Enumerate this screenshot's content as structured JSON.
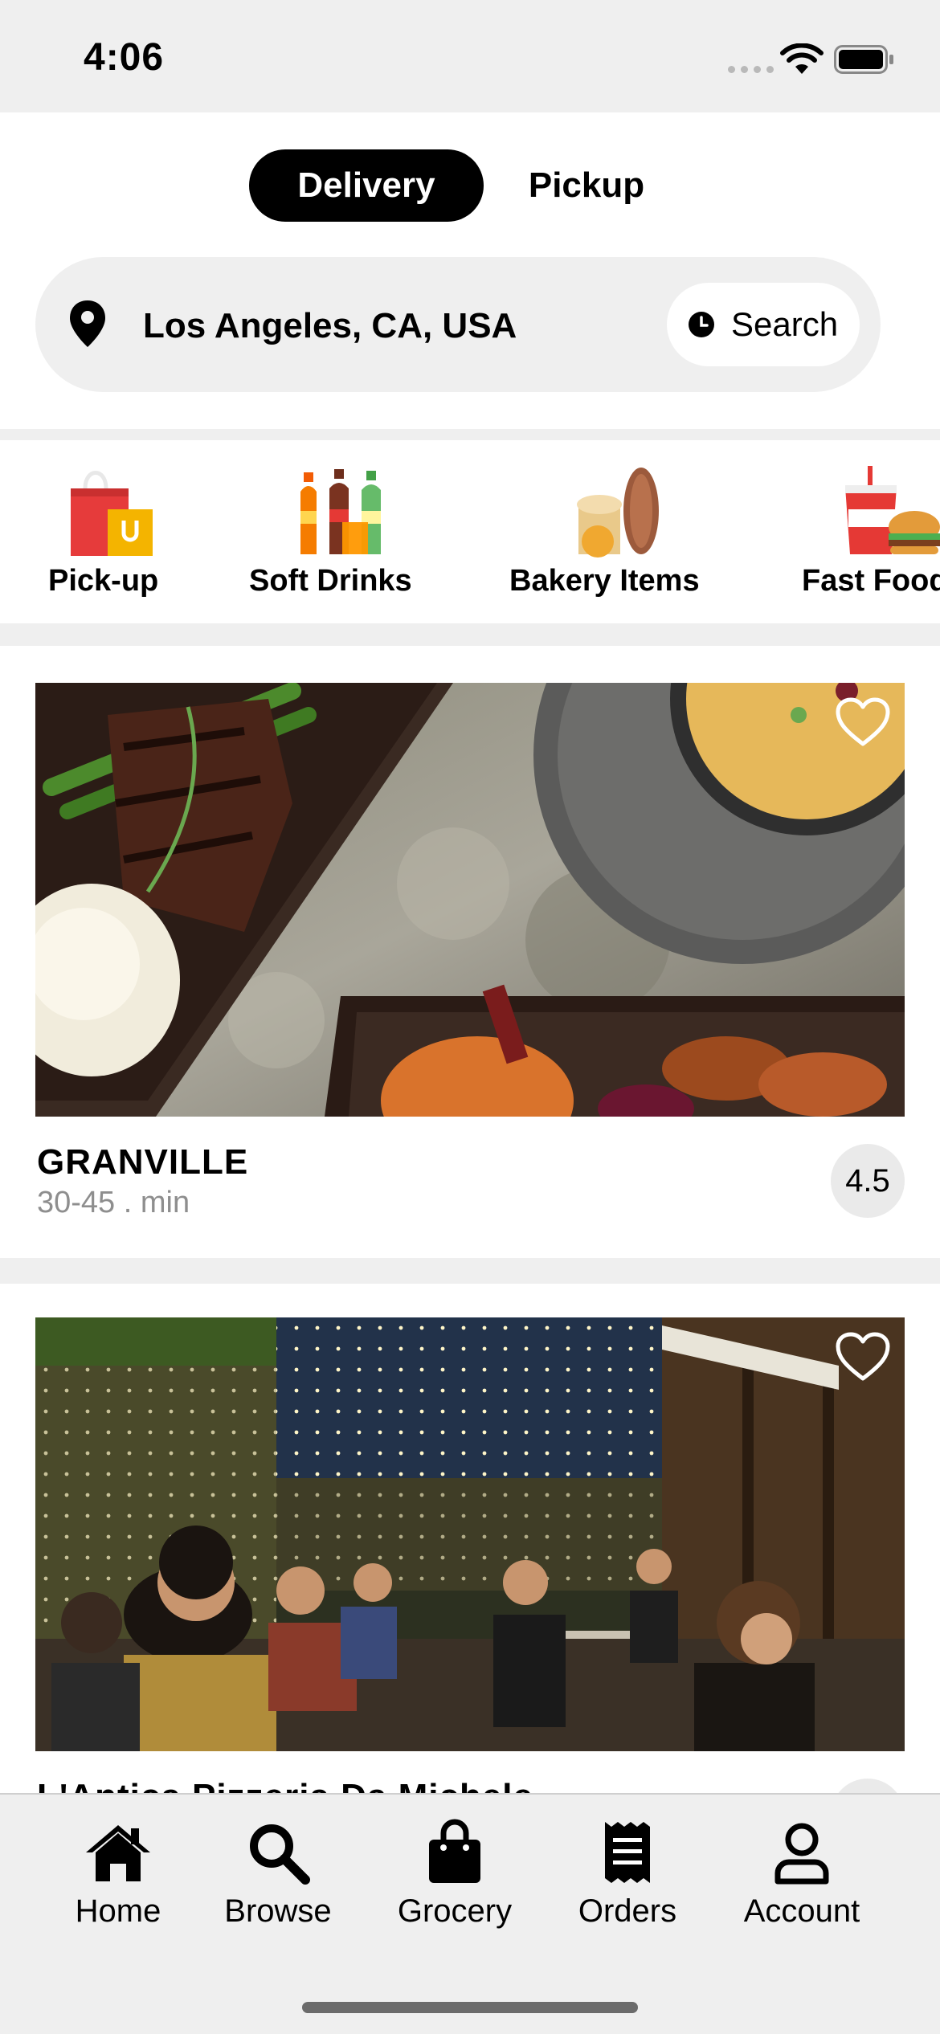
{
  "status_bar": {
    "time": "4:06"
  },
  "mode_toggle": {
    "delivery_label": "Delivery",
    "pickup_label": "Pickup",
    "selected": "Delivery"
  },
  "search": {
    "location": "Los Angeles, CA, USA",
    "button_label": "Search"
  },
  "categories": [
    {
      "label": "Pick-up",
      "icon": "shopping-bags-icon"
    },
    {
      "label": "Soft Drinks",
      "icon": "soda-bottles-icon"
    },
    {
      "label": "Bakery Items",
      "icon": "bread-icon"
    },
    {
      "label": "Fast Food",
      "icon": "burger-drink-icon"
    }
  ],
  "restaurants": [
    {
      "name": "GRANVILLE",
      "time": "30-45 . min",
      "rating": "4.5",
      "favorite": false
    },
    {
      "name": "L'Antica Pizzeria Da Michele",
      "time": "",
      "rating": "",
      "favorite": false
    }
  ],
  "tabbar": [
    {
      "label": "Home",
      "icon": "home-icon"
    },
    {
      "label": "Browse",
      "icon": "search-icon"
    },
    {
      "label": "Grocery",
      "icon": "grocery-bag-icon"
    },
    {
      "label": "Orders",
      "icon": "receipt-icon"
    },
    {
      "label": "Account",
      "icon": "account-icon"
    }
  ],
  "colors": {
    "accent": "#000000",
    "background_gray": "#efefef",
    "secondary_text": "#8e8e8e"
  }
}
